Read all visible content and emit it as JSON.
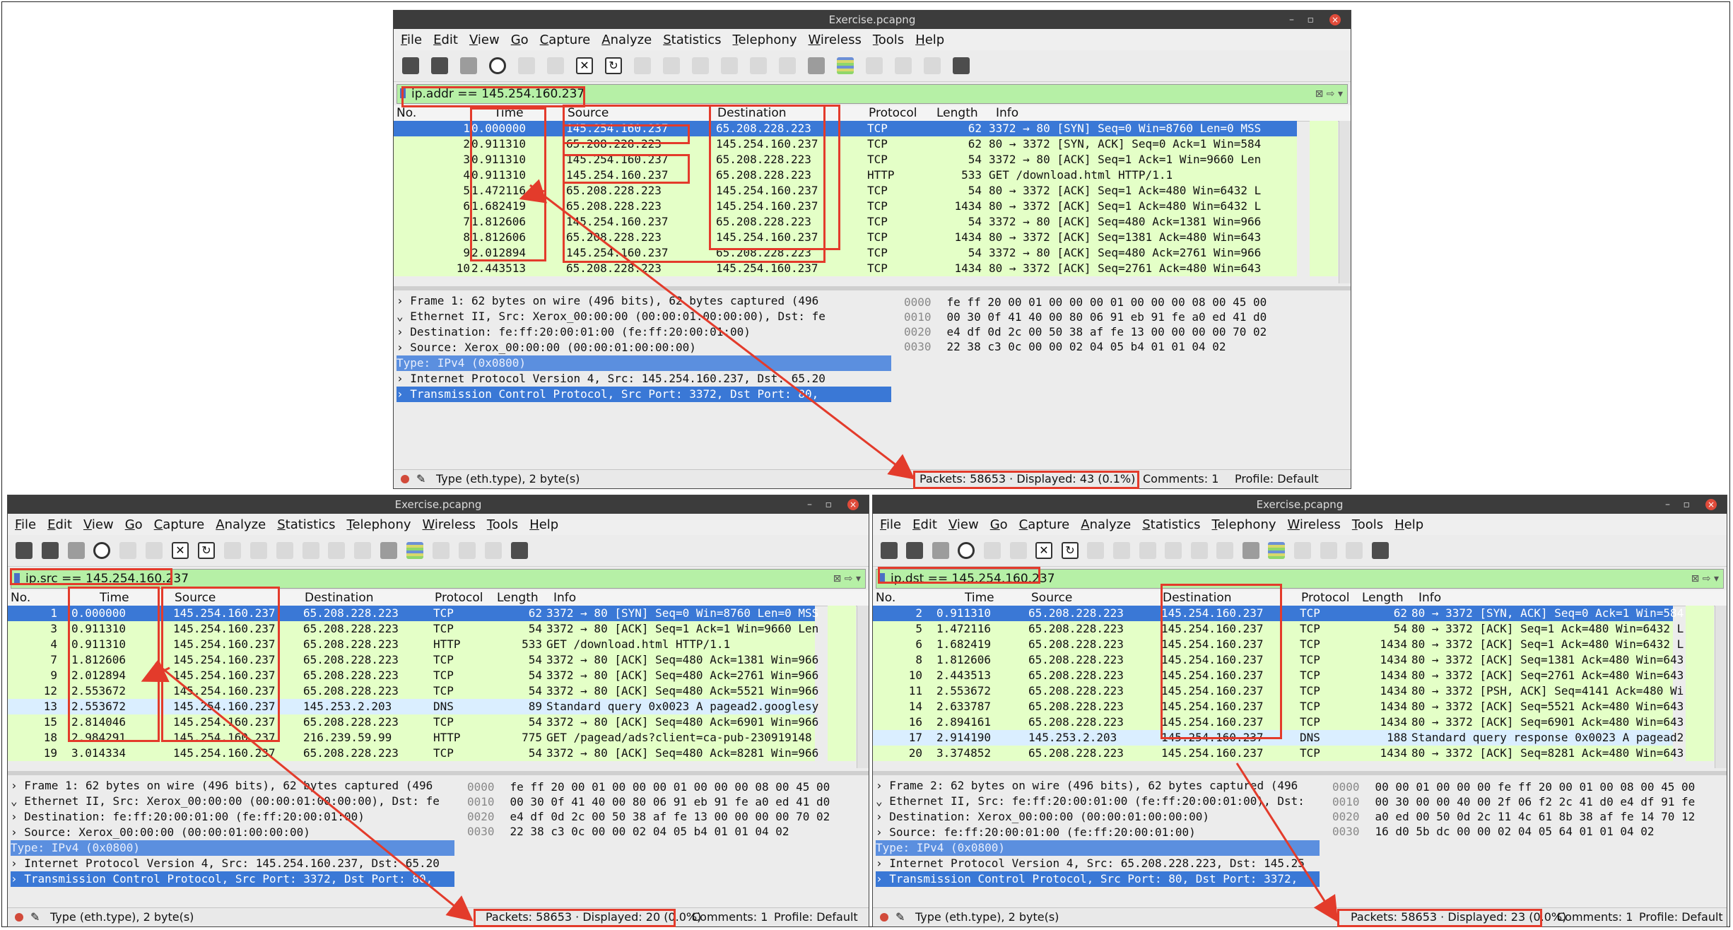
{
  "windows": [
    {
      "id": "top",
      "title": "Exercise.pcapng",
      "menu": [
        "File",
        "Edit",
        "View",
        "Go",
        "Capture",
        "Analyze",
        "Statistics",
        "Telephony",
        "Wireless",
        "Tools",
        "Help"
      ],
      "filter": "ip.addr == 145.254.160.237",
      "columns": [
        "No.",
        "Time",
        "Source",
        "Destination",
        "Protocol",
        "Length",
        "Info"
      ],
      "rows": [
        {
          "no": "1",
          "time": "0.000000",
          "src": "145.254.160.237",
          "dst": "65.208.228.223",
          "proto": "TCP",
          "len": "62",
          "info": "3372 → 80 [SYN] Seq=0 Win=8760 Len=0 MSS"
        },
        {
          "no": "2",
          "time": "0.911310",
          "src": "65.208.228.223",
          "dst": "145.254.160.237",
          "proto": "TCP",
          "len": "62",
          "info": "80 → 3372 [SYN, ACK] Seq=0 Ack=1 Win=584"
        },
        {
          "no": "3",
          "time": "0.911310",
          "src": "145.254.160.237",
          "dst": "65.208.228.223",
          "proto": "TCP",
          "len": "54",
          "info": "3372 → 80 [ACK] Seq=1 Ack=1 Win=9660 Len"
        },
        {
          "no": "4",
          "time": "0.911310",
          "src": "145.254.160.237",
          "dst": "65.208.228.223",
          "proto": "HTTP",
          "len": "533",
          "info": "GET /download.html HTTP/1.1"
        },
        {
          "no": "5",
          "time": "1.472116",
          "src": "65.208.228.223",
          "dst": "145.254.160.237",
          "proto": "TCP",
          "len": "54",
          "info": "80 → 3372 [ACK] Seq=1 Ack=480 Win=6432 L"
        },
        {
          "no": "6",
          "time": "1.682419",
          "src": "65.208.228.223",
          "dst": "145.254.160.237",
          "proto": "TCP",
          "len": "1434",
          "info": "80 → 3372 [ACK] Seq=1 Ack=480 Win=6432 L"
        },
        {
          "no": "7",
          "time": "1.812606",
          "src": "145.254.160.237",
          "dst": "65.208.228.223",
          "proto": "TCP",
          "len": "54",
          "info": "3372 → 80 [ACK] Seq=480 Ack=1381 Win=966"
        },
        {
          "no": "8",
          "time": "1.812606",
          "src": "65.208.228.223",
          "dst": "145.254.160.237",
          "proto": "TCP",
          "len": "1434",
          "info": "80 → 3372 [ACK] Seq=1381 Ack=480 Win=643"
        },
        {
          "no": "9",
          "time": "2.012894",
          "src": "145.254.160.237",
          "dst": "65.208.228.223",
          "proto": "TCP",
          "len": "54",
          "info": "3372 → 80 [ACK] Seq=480 Ack=2761 Win=966"
        },
        {
          "no": "10",
          "time": "2.443513",
          "src": "65.208.228.223",
          "dst": "145.254.160.237",
          "proto": "TCP",
          "len": "1434",
          "info": "80 → 3372 [ACK] Seq=2761 Ack=480 Win=643"
        }
      ],
      "details": [
        "› Frame 1: 62 bytes on wire (496 bits), 62 bytes captured (496",
        "⌄ Ethernet II, Src: Xerox_00:00:00 (00:00:01:00:00:00), Dst: fe",
        "   › Destination: fe:ff:20:00:01:00 (fe:ff:20:00:01:00)",
        "   › Source: Xerox_00:00:00 (00:00:01:00:00:00)",
        "     Type: IPv4 (0x0800)",
        "› Internet Protocol Version 4, Src: 145.254.160.237, Dst: 65.20",
        "› Transmission Control Protocol, Src Port: 3372, Dst Port: 80,"
      ],
      "hex": [
        {
          "off": "0000",
          "a": "fe ff 20 00 01 00 00 00",
          "b": "01 00 00 00 08 00 45 00"
        },
        {
          "off": "0010",
          "a": "00 30 0f 41 40 00 80 06",
          "b": "91 eb 91 fe a0 ed 41 d0"
        },
        {
          "off": "0020",
          "a": "e4 df 0d 2c 00 50 38 af",
          "b": "fe 13 00 00 00 00 70 02"
        },
        {
          "off": "0030",
          "a": "22 38 c3 0c 00 00 02 04",
          "b": "05 b4 01 01 04 02"
        }
      ],
      "status": {
        "field": "Type (eth.type), 2 byte(s)",
        "packets": "Packets: 58653 · Displayed: 43 (0.1%)",
        "comments": "Comments: 1",
        "profile": "Profile: Default"
      }
    },
    {
      "id": "left",
      "title": "Exercise.pcapng",
      "menu": [
        "File",
        "Edit",
        "View",
        "Go",
        "Capture",
        "Analyze",
        "Statistics",
        "Telephony",
        "Wireless",
        "Tools",
        "Help"
      ],
      "filter": "ip.src == 145.254.160.237",
      "columns": [
        "No.",
        "Time",
        "Source",
        "Destination",
        "Protocol",
        "Length",
        "Info"
      ],
      "rows": [
        {
          "no": "1",
          "time": "0.000000",
          "src": "145.254.160.237",
          "dst": "65.208.228.223",
          "proto": "TCP",
          "len": "62",
          "info": "3372 → 80 [SYN] Seq=0 Win=8760 Len=0 MSS"
        },
        {
          "no": "3",
          "time": "0.911310",
          "src": "145.254.160.237",
          "dst": "65.208.228.223",
          "proto": "TCP",
          "len": "54",
          "info": "3372 → 80 [ACK] Seq=1 Ack=1 Win=9660 Len"
        },
        {
          "no": "4",
          "time": "0.911310",
          "src": "145.254.160.237",
          "dst": "65.208.228.223",
          "proto": "HTTP",
          "len": "533",
          "info": "GET /download.html HTTP/1.1"
        },
        {
          "no": "7",
          "time": "1.812606",
          "src": "145.254.160.237",
          "dst": "65.208.228.223",
          "proto": "TCP",
          "len": "54",
          "info": "3372 → 80 [ACK] Seq=480 Ack=1381 Win=966"
        },
        {
          "no": "9",
          "time": "2.012894",
          "src": "145.254.160.237",
          "dst": "65.208.228.223",
          "proto": "TCP",
          "len": "54",
          "info": "3372 → 80 [ACK] Seq=480 Ack=2761 Win=966"
        },
        {
          "no": "12",
          "time": "2.553672",
          "src": "145.254.160.237",
          "dst": "65.208.228.223",
          "proto": "TCP",
          "len": "54",
          "info": "3372 → 80 [ACK] Seq=480 Ack=5521 Win=966"
        },
        {
          "no": "13",
          "time": "2.553672",
          "src": "145.254.160.237",
          "dst": "145.253.2.203",
          "proto": "DNS",
          "len": "89",
          "info": "Standard query 0x0023 A pagead2.googlesy"
        },
        {
          "no": "15",
          "time": "2.814046",
          "src": "145.254.160.237",
          "dst": "65.208.228.223",
          "proto": "TCP",
          "len": "54",
          "info": "3372 → 80 [ACK] Seq=480 Ack=6901 Win=966"
        },
        {
          "no": "18",
          "time": "2.984291",
          "src": "145.254.160.237",
          "dst": "216.239.59.99",
          "proto": "HTTP",
          "len": "775",
          "info": "GET /pagead/ads?client=ca-pub-230919148"
        },
        {
          "no": "19",
          "time": "3.014334",
          "src": "145.254.160.237",
          "dst": "65.208.228.223",
          "proto": "TCP",
          "len": "54",
          "info": "3372 → 80 [ACK] Seq=480 Ack=8281 Win=966"
        }
      ],
      "details": [
        "› Frame 1: 62 bytes on wire (496 bits), 62 bytes captured (496",
        "⌄ Ethernet II, Src: Xerox_00:00:00 (00:00:01:00:00:00), Dst: fe",
        "   › Destination: fe:ff:20:00:01:00 (fe:ff:20:00:01:00)",
        "   › Source: Xerox_00:00:00 (00:00:01:00:00:00)",
        "     Type: IPv4 (0x0800)",
        "› Internet Protocol Version 4, Src: 145.254.160.237, Dst: 65.20",
        "› Transmission Control Protocol, Src Port: 3372, Dst Port: 80,"
      ],
      "hex": [
        {
          "off": "0000",
          "a": "fe ff 20 00 01 00 00 00",
          "b": "01 00 00 00 08 00 45 00"
        },
        {
          "off": "0010",
          "a": "00 30 0f 41 40 00 80 06",
          "b": "91 eb 91 fe a0 ed 41 d0"
        },
        {
          "off": "0020",
          "a": "e4 df 0d 2c 00 50 38 af",
          "b": "fe 13 00 00 00 00 70 02"
        },
        {
          "off": "0030",
          "a": "22 38 c3 0c 00 00 02 04",
          "b": "05 b4 01 01 04 02"
        }
      ],
      "status": {
        "field": "Type (eth.type), 2 byte(s)",
        "packets": "Packets: 58653 · Displayed: 20 (0.0%)",
        "comments": "Comments: 1",
        "profile": "Profile: Default"
      }
    },
    {
      "id": "right",
      "title": "Exercise.pcapng",
      "menu": [
        "File",
        "Edit",
        "View",
        "Go",
        "Capture",
        "Analyze",
        "Statistics",
        "Telephony",
        "Wireless",
        "Tools",
        "Help"
      ],
      "filter": "ip.dst == 145.254.160.237",
      "columns": [
        "No.",
        "Time",
        "Source",
        "Destination",
        "Protocol",
        "Length",
        "Info"
      ],
      "rows": [
        {
          "no": "2",
          "time": "0.911310",
          "src": "65.208.228.223",
          "dst": "145.254.160.237",
          "proto": "TCP",
          "len": "62",
          "info": "80 → 3372 [SYN, ACK] Seq=0 Ack=1 Win=584"
        },
        {
          "no": "5",
          "time": "1.472116",
          "src": "65.208.228.223",
          "dst": "145.254.160.237",
          "proto": "TCP",
          "len": "54",
          "info": "80 → 3372 [ACK] Seq=1 Ack=480 Win=6432 L"
        },
        {
          "no": "6",
          "time": "1.682419",
          "src": "65.208.228.223",
          "dst": "145.254.160.237",
          "proto": "TCP",
          "len": "1434",
          "info": "80 → 3372 [ACK] Seq=1 Ack=480 Win=6432 L"
        },
        {
          "no": "8",
          "time": "1.812606",
          "src": "65.208.228.223",
          "dst": "145.254.160.237",
          "proto": "TCP",
          "len": "1434",
          "info": "80 → 3372 [ACK] Seq=1381 Ack=480 Win=643"
        },
        {
          "no": "10",
          "time": "2.443513",
          "src": "65.208.228.223",
          "dst": "145.254.160.237",
          "proto": "TCP",
          "len": "1434",
          "info": "80 → 3372 [ACK] Seq=2761 Ack=480 Win=643"
        },
        {
          "no": "11",
          "time": "2.553672",
          "src": "65.208.228.223",
          "dst": "145.254.160.237",
          "proto": "TCP",
          "len": "1434",
          "info": "80 → 3372 [PSH, ACK] Seq=4141 Ack=480 Wi"
        },
        {
          "no": "14",
          "time": "2.633787",
          "src": "65.208.228.223",
          "dst": "145.254.160.237",
          "proto": "TCP",
          "len": "1434",
          "info": "80 → 3372 [ACK] Seq=5521 Ack=480 Win=643"
        },
        {
          "no": "16",
          "time": "2.894161",
          "src": "65.208.228.223",
          "dst": "145.254.160.237",
          "proto": "TCP",
          "len": "1434",
          "info": "80 → 3372 [ACK] Seq=6901 Ack=480 Win=643"
        },
        {
          "no": "17",
          "time": "2.914190",
          "src": "145.253.2.203",
          "dst": "145.254.160.237",
          "proto": "DNS",
          "len": "188",
          "info": "Standard query response 0x0023 A pagead2"
        },
        {
          "no": "20",
          "time": "3.374852",
          "src": "65.208.228.223",
          "dst": "145.254.160.237",
          "proto": "TCP",
          "len": "1434",
          "info": "80 → 3372 [ACK] Seq=8281 Ack=480 Win=643"
        }
      ],
      "details": [
        "› Frame 2: 62 bytes on wire (496 bits), 62 bytes captured (496",
        "⌄ Ethernet II, Src: fe:ff:20:00:01:00 (fe:ff:20:00:01:00), Dst:",
        "   › Destination: Xerox_00:00:00 (00:00:01:00:00:00)",
        "   › Source: fe:ff:20:00:01:00 (fe:ff:20:00:01:00)",
        "     Type: IPv4 (0x0800)",
        "› Internet Protocol Version 4, Src: 65.208.228.223, Dst: 145.25",
        "› Transmission Control Protocol, Src Port: 80, Dst Port: 3372,"
      ],
      "hex": [
        {
          "off": "0000",
          "a": "00 00 01 00 00 00 fe ff",
          "b": "20 00 01 00 08 00 45 00"
        },
        {
          "off": "0010",
          "a": "00 30 00 00 40 00 2f 06",
          "b": "f2 2c 41 d0 e4 df 91 fe"
        },
        {
          "off": "0020",
          "a": "a0 ed 00 50 0d 2c 11 4c",
          "b": "61 8b 38 af fe 14 70 12"
        },
        {
          "off": "0030",
          "a": "16 d0 5b dc 00 00 02 04",
          "b": "05 64 01 01 04 02"
        }
      ],
      "status": {
        "field": "Type (eth.type), 2 byte(s)",
        "packets": "Packets: 58653 · Displayed: 23 (0.0%)",
        "comments": "Comments: 1",
        "profile": "Profile: Default"
      }
    }
  ],
  "colors": {
    "accent_red": "#e33b2b",
    "selected_row": "#3a78d6",
    "tcp_row": "#e4ffc7",
    "dns_row": "#daeeff",
    "filter_ok": "#b6f0a6"
  }
}
